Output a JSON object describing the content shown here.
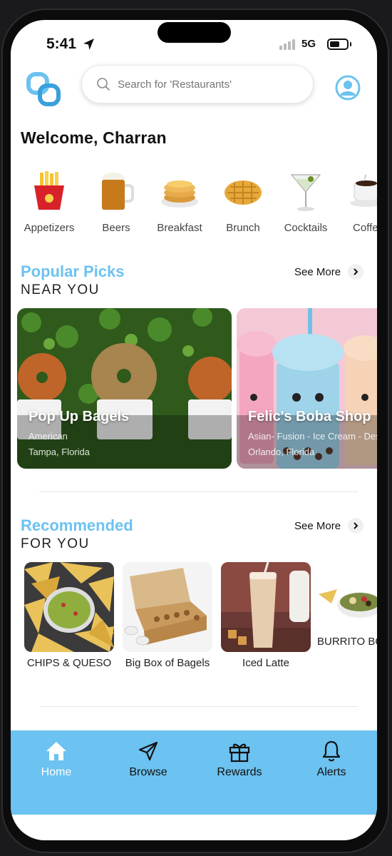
{
  "status_bar": {
    "time": "5:41",
    "network": "5G"
  },
  "search": {
    "placeholder": "Search for 'Restaurants'"
  },
  "welcome": "Welcome, Charran",
  "categories": [
    {
      "label": "Appetizers",
      "icon": "fries-icon"
    },
    {
      "label": "Beers",
      "icon": "beer-mug-icon"
    },
    {
      "label": "Breakfast",
      "icon": "pancakes-icon"
    },
    {
      "label": "Brunch",
      "icon": "waffle-icon"
    },
    {
      "label": "Cocktails",
      "icon": "cocktail-glass-icon"
    },
    {
      "label": "Coffee",
      "icon": "coffee-cup-icon"
    }
  ],
  "popular": {
    "title": "Popular Picks",
    "subtitle": "NEAR YOU",
    "see_more": "See More",
    "cards": [
      {
        "name": "Pop Up Bagels",
        "cuisine": "American",
        "location": "Tampa, Florida"
      },
      {
        "name": "Felic's Boba Shop",
        "cuisine": "Asian- Fusion - Ice Cream - Dess",
        "location": "Orlando, Florida"
      }
    ]
  },
  "recommended": {
    "title": "Recommended",
    "subtitle": "FOR YOU",
    "see_more": "See More",
    "items": [
      {
        "label": "CHIPS & QUESO"
      },
      {
        "label": "Big Box of Bagels"
      },
      {
        "label": "Iced Latte"
      },
      {
        "label": "BURRITO BOWL"
      }
    ]
  },
  "tabs": [
    {
      "label": "Home",
      "icon": "home-icon",
      "active": true
    },
    {
      "label": "Browse",
      "icon": "navigation-arrow-icon"
    },
    {
      "label": "Rewards",
      "icon": "gift-icon"
    },
    {
      "label": "Alerts",
      "icon": "bell-icon"
    }
  ],
  "colors": {
    "accent": "#6cc2f0",
    "text": "#111111"
  }
}
